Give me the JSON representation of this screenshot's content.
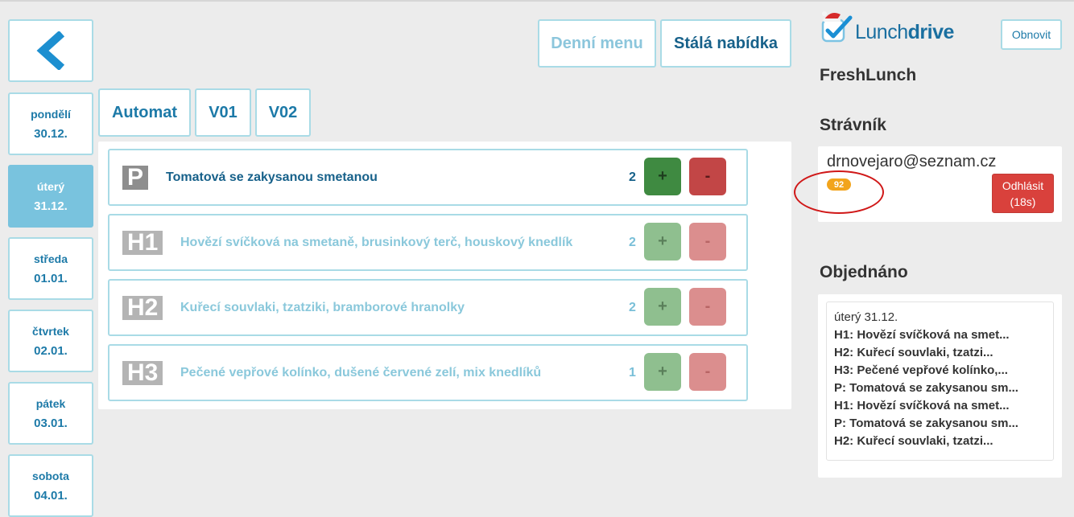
{
  "nav": {
    "back_label": "Back",
    "days": [
      {
        "name": "pondělí",
        "date": "30.12."
      },
      {
        "name": "úterý",
        "date": "31.12."
      },
      {
        "name": "středa",
        "date": "01.01."
      },
      {
        "name": "čtvrtek",
        "date": "02.01."
      },
      {
        "name": "pátek",
        "date": "03.01."
      },
      {
        "name": "sobota",
        "date": "04.01."
      }
    ],
    "active_day_index": 1
  },
  "menu_type": {
    "daily_label": "Denní menu",
    "permanent_label": "Stálá nabídka"
  },
  "tabs": [
    "Automat",
    "V01",
    "V02"
  ],
  "items": [
    {
      "code": "P",
      "name": "Tomatová se zakysanou smetanou",
      "count": "2",
      "plus": "+",
      "minus": "-"
    },
    {
      "code": "H1",
      "name": "Hovězí svíčková na smetaně, brusinkový terč, houskový knedlík",
      "count": "2",
      "plus": "+",
      "minus": "-"
    },
    {
      "code": "H2",
      "name": "Kuřecí souvlaki, tzatziki, bramborové hranolky",
      "count": "2",
      "plus": "+",
      "minus": "-"
    },
    {
      "code": "H3",
      "name": "Pečené vepřové kolínko, dušené červené zelí, mix knedlíků",
      "count": "1",
      "plus": "+",
      "minus": "-"
    }
  ],
  "brand": {
    "logo_text_light": "Lunch",
    "logo_text_bold": "drive",
    "refresh_label": "Obnovit",
    "canteen": "FreshLunch"
  },
  "diner": {
    "heading": "Strávník",
    "email": "drnovejaro@seznam.cz",
    "credit": "92",
    "logout_label": "Odhlásit",
    "logout_timer": "(18s)"
  },
  "orders": {
    "heading": "Objednáno",
    "date": "úterý 31.12.",
    "lines": [
      "H1: Hovězí svíčková na smet...",
      "H2: Kuřecí souvlaki, tzatzi...",
      "H3: Pečené vepřové kolínko,...",
      "P: Tomatová se zakysanou sm...",
      "H1: Hovězí svíčková na smet...",
      "P: Tomatová se zakysanou sm...",
      "H2: Kuřecí souvlaki, tzatzi..."
    ]
  },
  "colors": {
    "accent": "#1d7aa8",
    "active_day": "#79c3de",
    "plus": "#3f8a41",
    "minus": "#c24646",
    "credit_badge": "#f2a41c",
    "annotation": "#d01818"
  }
}
